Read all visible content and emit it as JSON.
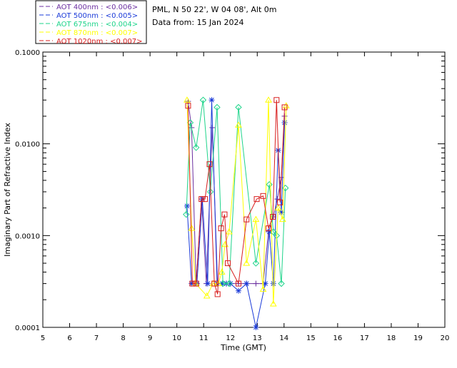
{
  "chart_data": {
    "type": "scatter",
    "xlabel": "Time (GMT)",
    "ylabel": "Imaginary Part of Refractive Index",
    "xlim": [
      5,
      20
    ],
    "ylim": [
      0.0001,
      0.1
    ],
    "yscale": "log",
    "grid": false,
    "legend_position": "top-left",
    "x_ticks": [
      "5",
      "6",
      "7",
      "8",
      "9",
      "10",
      "11",
      "12",
      "13",
      "14",
      "15",
      "16",
      "17",
      "18",
      "19",
      "20"
    ],
    "y_ticks": [
      {
        "value": 0.0001,
        "label": "0.0001"
      },
      {
        "value": 0.001,
        "label": "0.0010"
      },
      {
        "value": 0.01,
        "label": "0.0100"
      },
      {
        "value": 0.1,
        "label": "0.1000"
      }
    ],
    "info": {
      "location": "PML, N 50 22', W 04 08', Alt 0m",
      "date": "Data from: 15 Jan 2024"
    },
    "series": [
      {
        "name": "AOT  400nm : <0.006>",
        "color": "#6b2fa0",
        "marker": "plus",
        "x": [
          10.42,
          10.55,
          10.72,
          10.92,
          11.1,
          11.32,
          11.52,
          11.7,
          11.85,
          12.0,
          12.3,
          12.6,
          12.95,
          13.22,
          13.42,
          13.6,
          13.75,
          13.9,
          14.02
        ],
        "y": [
          0.029,
          0.015,
          0.0003,
          0.0025,
          0.0003,
          0.015,
          0.0003,
          0.0003,
          0.0003,
          0.0003,
          0.0003,
          0.0003,
          0.0003,
          0.0003,
          0.0011,
          0.0016,
          0.0025,
          0.0043,
          0.02
        ]
      },
      {
        "name": "AOT  500nm : <0.005>",
        "color": "#1a3ad8",
        "marker": "asterisk",
        "x": [
          10.38,
          10.55,
          10.75,
          10.95,
          11.15,
          11.3,
          11.5,
          11.7,
          11.85,
          12.0,
          12.3,
          12.6,
          12.95,
          13.3,
          13.45,
          13.6,
          13.78,
          13.9,
          14.02
        ],
        "y": [
          0.0021,
          0.0003,
          0.0003,
          0.0025,
          0.0003,
          0.03,
          0.0003,
          0.0003,
          0.0003,
          0.0003,
          0.00025,
          0.0003,
          0.0001,
          0.0003,
          0.0011,
          0.0003,
          0.0085,
          0.0018,
          0.017
        ]
      },
      {
        "name": "AOT  675nm : <0.004>",
        "color": "#1ed48a",
        "marker": "diamond",
        "x": [
          10.35,
          10.5,
          10.72,
          10.98,
          11.25,
          11.5,
          11.72,
          11.95,
          12.3,
          12.95,
          13.45,
          13.6,
          13.72,
          13.9,
          14.05
        ],
        "y": [
          0.0017,
          0.017,
          0.0091,
          0.03,
          0.003,
          0.025,
          0.0003,
          0.0003,
          0.025,
          0.0005,
          0.0036,
          0.0011,
          0.001,
          0.0003,
          0.0033
        ]
      },
      {
        "name": "AOT  870nm : <0.007>",
        "color": "#ffff00",
        "marker": "triangle",
        "x": [
          10.38,
          10.55,
          10.7,
          11.12,
          11.35,
          11.55,
          11.68,
          11.8,
          11.95,
          12.3,
          12.6,
          12.95,
          13.22,
          13.42,
          13.6,
          13.78,
          13.95,
          14.08
        ],
        "y": [
          0.03,
          0.0012,
          0.0003,
          0.00022,
          0.0003,
          0.0003,
          0.0004,
          0.0008,
          0.0011,
          0.016,
          0.0005,
          0.0015,
          0.00026,
          0.03,
          0.00018,
          0.002,
          0.0015,
          0.026
        ]
      },
      {
        "name": "AOT 1020nm : <0.007>",
        "color": "#d81e1e",
        "marker": "square",
        "x": [
          10.42,
          10.58,
          10.72,
          10.92,
          11.05,
          11.22,
          11.4,
          11.52,
          11.65,
          11.78,
          11.9,
          12.3,
          12.6,
          12.98,
          13.22,
          13.42,
          13.58,
          13.72,
          13.85,
          14.02
        ],
        "y": [
          0.026,
          0.0003,
          0.0003,
          0.0025,
          0.0025,
          0.006,
          0.0003,
          0.00023,
          0.0012,
          0.0017,
          0.0005,
          0.0003,
          0.0015,
          0.0025,
          0.0027,
          0.0012,
          0.0016,
          0.03,
          0.0023,
          0.025
        ]
      }
    ]
  }
}
